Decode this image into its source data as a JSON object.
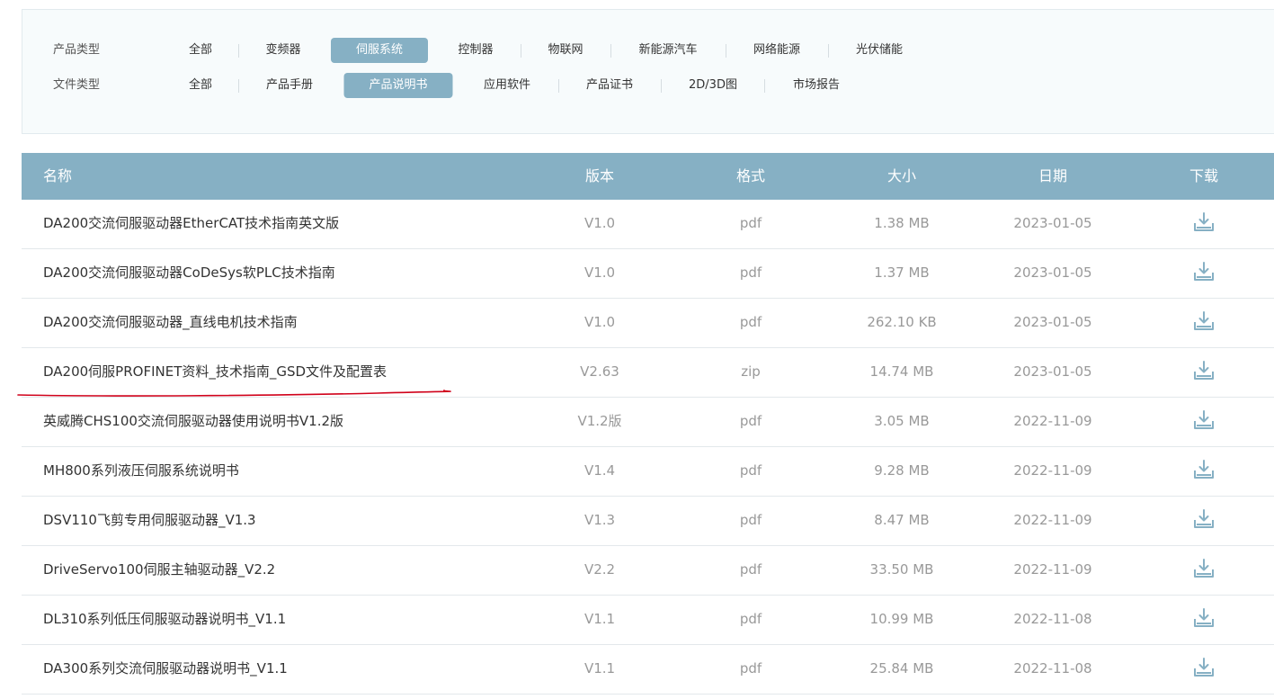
{
  "filters": {
    "product_type": {
      "label": "产品类型",
      "options": [
        "全部",
        "变频器",
        "伺服系统",
        "控制器",
        "物联网",
        "新能源汽车",
        "网络能源",
        "光伏储能"
      ],
      "selected": "伺服系统"
    },
    "file_type": {
      "label": "文件类型",
      "options": [
        "全部",
        "产品手册",
        "产品说明书",
        "应用软件",
        "产品证书",
        "2D/3D图",
        "市场报告"
      ],
      "selected": "产品说明书"
    }
  },
  "table": {
    "headers": {
      "name": "名称",
      "version": "版本",
      "format": "格式",
      "size": "大小",
      "date": "日期",
      "download": "下载"
    },
    "rows": [
      {
        "name": "DA200交流伺服驱动器EtherCAT技术指南英文版",
        "version": "V1.0",
        "format": "pdf",
        "size": "1.38 MB",
        "date": "2023-01-05"
      },
      {
        "name": "DA200交流伺服驱动器CoDeSys软PLC技术指南",
        "version": "V1.0",
        "format": "pdf",
        "size": "1.37 MB",
        "date": "2023-01-05"
      },
      {
        "name": "DA200交流伺服驱动器_直线电机技术指南",
        "version": "V1.0",
        "format": "pdf",
        "size": "262.10 KB",
        "date": "2023-01-05"
      },
      {
        "name": "DA200伺服PROFINET资料_技术指南_GSD文件及配置表",
        "version": "V2.63",
        "format": "zip",
        "size": "14.74 MB",
        "date": "2023-01-05"
      },
      {
        "name": "英威腾CHS100交流伺服驱动器使用说明书V1.2版",
        "version": "V1.2版",
        "format": "pdf",
        "size": "3.05 MB",
        "date": "2022-11-09"
      },
      {
        "name": "MH800系列液压伺服系统说明书",
        "version": "V1.4",
        "format": "pdf",
        "size": "9.28 MB",
        "date": "2022-11-09"
      },
      {
        "name": "DSV110飞剪专用伺服驱动器_V1.3",
        "version": "V1.3",
        "format": "pdf",
        "size": "8.47 MB",
        "date": "2022-11-09"
      },
      {
        "name": "DriveServo100伺服主轴驱动器_V2.2",
        "version": "V2.2",
        "format": "pdf",
        "size": "33.50 MB",
        "date": "2022-11-09"
      },
      {
        "name": "DL310系列低压伺服驱动器说明书_V1.1",
        "version": "V1.1",
        "format": "pdf",
        "size": "10.99 MB",
        "date": "2022-11-08"
      },
      {
        "name": "DA300系列交流伺服驱动器说明书_V1.1",
        "version": "V1.1",
        "format": "pdf",
        "size": "25.84 MB",
        "date": "2022-11-08"
      }
    ]
  },
  "icons": {
    "download": "download-icon"
  },
  "colors": {
    "accent": "#86b0c4",
    "annotation_line": "#d0021b"
  }
}
